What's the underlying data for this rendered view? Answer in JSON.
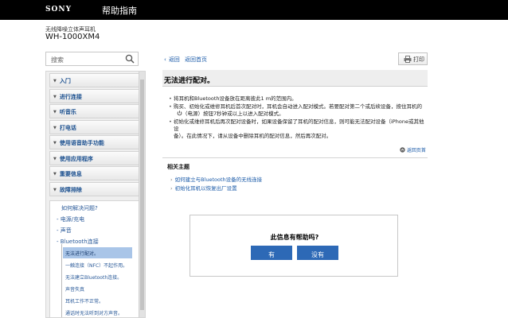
{
  "header": {
    "brand": "SONY",
    "title": "帮助指南"
  },
  "product": {
    "subtitle": "无线降噪立体声耳机",
    "model": "WH-1000XM4"
  },
  "search": {
    "placeholder": "搜索"
  },
  "sidebar": {
    "items": [
      {
        "label": "入门"
      },
      {
        "label": "进行连接"
      },
      {
        "label": "听音乐"
      },
      {
        "label": "打电话"
      },
      {
        "label": "使用语音助手功能"
      },
      {
        "label": "使用应用程序"
      },
      {
        "label": "重要信息"
      },
      {
        "label": "故障排除"
      }
    ],
    "subitems": [
      {
        "label": "如何解决问题?"
      },
      {
        "label": "- 电源/充电"
      },
      {
        "label": "- 声音"
      },
      {
        "label": "- Bluetooth连接"
      }
    ],
    "leaves": [
      {
        "label": "无法进行配对。",
        "active": true
      },
      {
        "label": "一触连接（NFC）不起作用。"
      },
      {
        "label": "无法建立Bluetooth连接。"
      },
      {
        "label": "声音失真"
      },
      {
        "label": "耳机工作不正常。"
      },
      {
        "label": "通话时无法听到对方声音。"
      }
    ]
  },
  "nav": {
    "back": "返回",
    "top": "返回首页",
    "print": "打印"
  },
  "article": {
    "title": "无法进行配对。",
    "tips": [
      {
        "lines": [
          "将耳机和Bluetooth设备放在距离彼此1 m的范围内。"
        ]
      },
      {
        "lines": [
          "购买、初始化或维修耳机后首次配对时，耳机会自动进入配对模式。若要配对第二个或后续设备，按住耳机的"
        ],
        "indent_pre": "（电源）按钮7秒钟或以上以进入配对模式。"
      },
      {
        "lines": [
          "初始化或维修耳机后再次配对设备时，如果设备保留了耳机的配对信息，则可能无法配对设备（iPhone或其他设",
          "备）。在此情况下，请从设备中删除耳机的配对信息，然后再次配对。"
        ]
      }
    ],
    "back_to_top": "返回页首"
  },
  "related": {
    "heading": "相关主题",
    "links": [
      {
        "label": "如何建立与Bluetooth设备的无线连接"
      },
      {
        "label": "初始化耳机以恢复出厂设置"
      }
    ]
  },
  "feedback": {
    "question": "此信息有帮助吗?",
    "yes": "有",
    "no": "没有"
  },
  "colors": {
    "link": "#1a5aa8",
    "button": "#2d69b6",
    "topbar": "#000000",
    "active_leaf": "#a9c5e8"
  }
}
